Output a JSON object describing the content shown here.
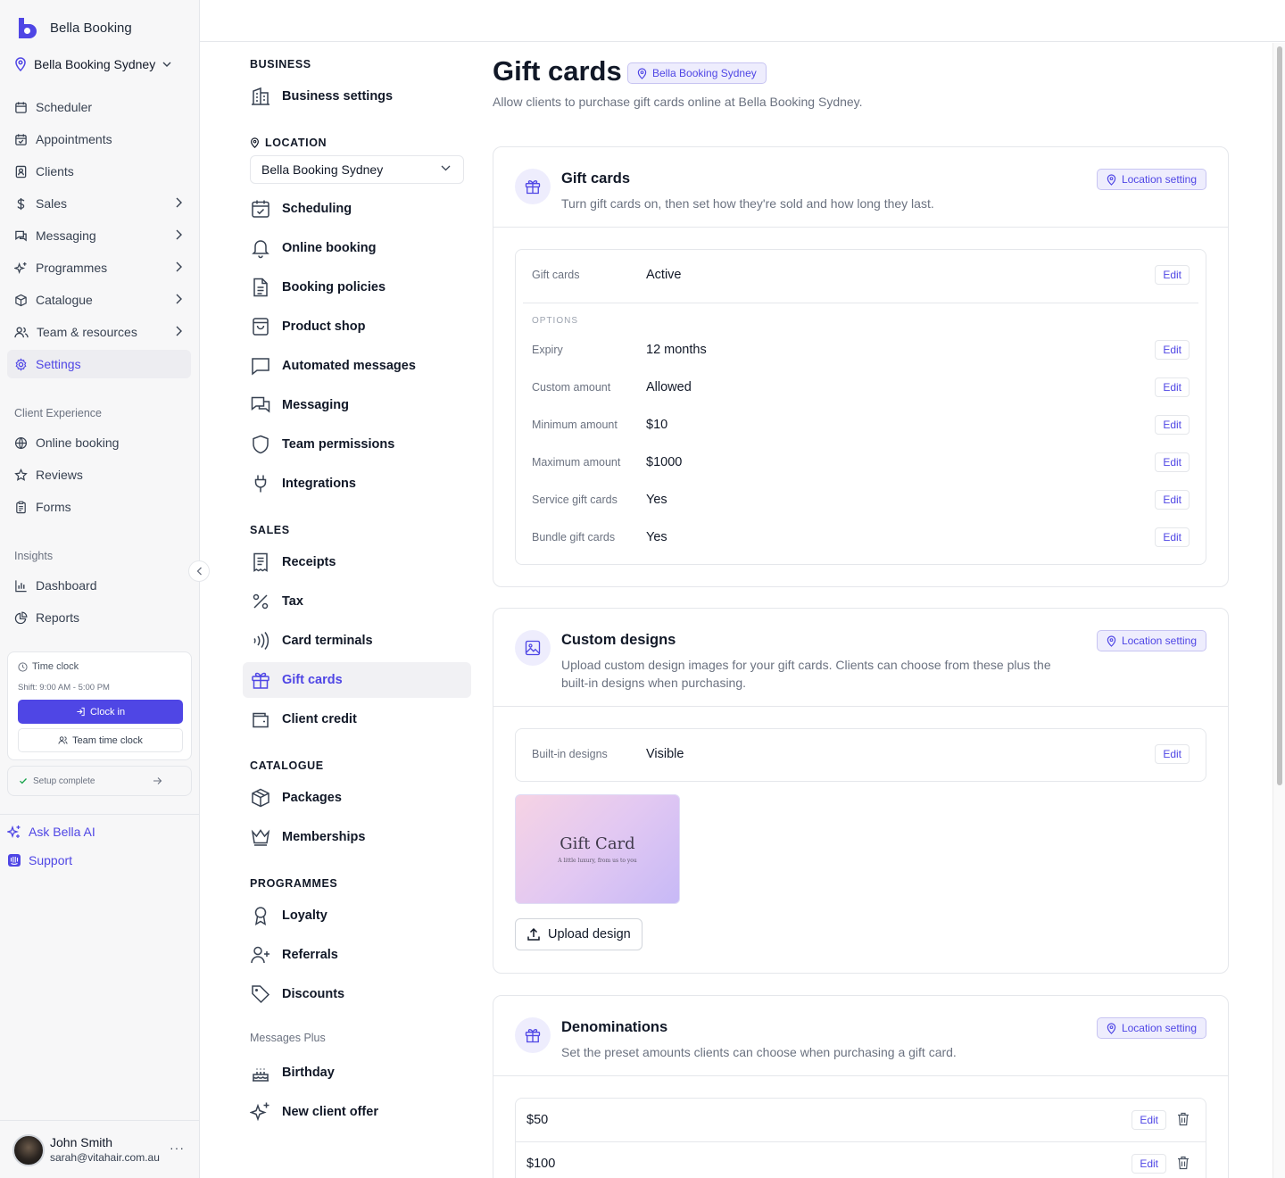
{
  "app": {
    "name": "Bella Booking",
    "location": "Bella Booking Sydney"
  },
  "sidebar": {
    "items": [
      {
        "label": "Scheduler",
        "icon": "calendar-icon"
      },
      {
        "label": "Appointments",
        "icon": "calendar-check-icon"
      },
      {
        "label": "Clients",
        "icon": "contact-icon"
      },
      {
        "label": "Sales",
        "icon": "dollar-icon"
      },
      {
        "label": "Messaging",
        "icon": "chat-icon"
      },
      {
        "label": "Programmes",
        "icon": "sparkles-icon"
      },
      {
        "label": "Catalogue",
        "icon": "box-icon"
      },
      {
        "label": "Team & resources",
        "icon": "users-icon"
      },
      {
        "label": "Settings",
        "icon": "gear-icon"
      }
    ],
    "client_experience_title": "Client Experience",
    "client_experience": [
      {
        "label": "Online booking",
        "icon": "globe-icon"
      },
      {
        "label": "Reviews",
        "icon": "star-icon"
      },
      {
        "label": "Forms",
        "icon": "clipboard-icon"
      }
    ],
    "insights_title": "Insights",
    "insights": [
      {
        "label": "Dashboard",
        "icon": "bar-chart-icon"
      },
      {
        "label": "Reports",
        "icon": "pie-chart-icon"
      }
    ],
    "time_clock": {
      "title": "Time clock",
      "shift": "Shift: 9:00 AM - 5:00 PM",
      "clock_in": "Clock in",
      "team_time_clock": "Team time clock"
    },
    "setup": "Setup complete",
    "ask_ai": "Ask Bella AI",
    "support": "Support",
    "user": {
      "name": "John Smith",
      "email": "sarah@vitahair.com.au",
      "more": "···"
    }
  },
  "settings_nav": {
    "business_title": "BUSINESS",
    "business_settings": "Business settings",
    "location_title": "LOCATION",
    "location_select": "Bella Booking Sydney",
    "location_items": [
      "Scheduling",
      "Online booking",
      "Booking policies",
      "Product shop",
      "Automated messages",
      "Messaging",
      "Team permissions",
      "Integrations"
    ],
    "sales_title": "SALES",
    "sales_items": [
      "Receipts",
      "Tax",
      "Card terminals",
      "Gift cards",
      "Client credit"
    ],
    "catalogue_title": "CATALOGUE",
    "catalogue_items": [
      "Packages",
      "Memberships"
    ],
    "programmes_title": "PROGRAMMES",
    "programmes_items": [
      "Loyalty",
      "Referrals",
      "Discounts"
    ],
    "messages_plus_title": "Messages Plus",
    "messages_plus_items": [
      "Birthday",
      "New client offer"
    ]
  },
  "page": {
    "title": "Gift cards",
    "badge": "Bella Booking Sydney",
    "subtitle": "Allow clients to purchase gift cards online at Bella Booking Sydney."
  },
  "gift_cards_card": {
    "title": "Gift cards",
    "description": "Turn gift cards on, then set how they're sold and how long they last.",
    "badge": "Location setting",
    "status": {
      "label": "Gift cards",
      "value": "Active",
      "edit": "Edit"
    },
    "options_title": "OPTIONS",
    "options": [
      {
        "label": "Expiry",
        "value": "12 months",
        "edit": "Edit"
      },
      {
        "label": "Custom amount",
        "value": "Allowed",
        "edit": "Edit"
      },
      {
        "label": "Minimum amount",
        "value": "$10",
        "edit": "Edit"
      },
      {
        "label": "Maximum amount",
        "value": "$1000",
        "edit": "Edit"
      },
      {
        "label": "Service gift cards",
        "value": "Yes",
        "edit": "Edit"
      },
      {
        "label": "Bundle gift cards",
        "value": "Yes",
        "edit": "Edit"
      }
    ]
  },
  "custom_designs_card": {
    "title": "Custom designs",
    "description": "Upload custom design images for your gift cards. Clients can choose from these plus the built-in designs when purchasing.",
    "badge": "Location setting",
    "builtin": {
      "label": "Built-in designs",
      "value": "Visible",
      "edit": "Edit"
    },
    "preview_title": "Gift Card",
    "preview_subtitle": "A little luxury, from us to you",
    "upload": "Upload design"
  },
  "denominations_card": {
    "title": "Denominations",
    "description": "Set the preset amounts clients can choose when purchasing a gift card.",
    "badge": "Location setting",
    "items": [
      {
        "amount": "$50",
        "edit": "Edit"
      },
      {
        "amount": "$100",
        "edit": "Edit"
      }
    ]
  },
  "colors": {
    "accent": "#4f46e5",
    "accent_soft": "#eeedfd",
    "border": "#e5e7eb",
    "muted": "#6b7280"
  }
}
